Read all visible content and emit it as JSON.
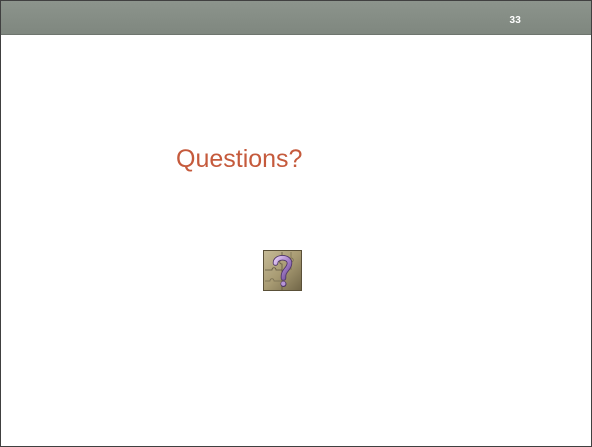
{
  "slide": {
    "page_number": "33",
    "title": "Questions?",
    "icon": "question-mark-puzzle-icon"
  },
  "colors": {
    "top_bar": "#858d85",
    "title": "#c55a3c",
    "border": "#404040",
    "background": "#ffffff"
  }
}
